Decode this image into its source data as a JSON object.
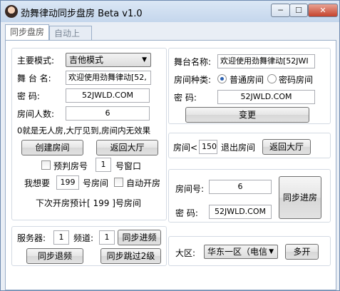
{
  "window": {
    "title": "劲舞律动同步盘房 Beta v1.0",
    "min_glyph": "─",
    "max_glyph": "☐",
    "close_glyph": "✕"
  },
  "tabs": [
    {
      "label": "同步盘房"
    },
    {
      "label": "自动上号"
    }
  ],
  "left": {
    "mode_label": "主要模式:",
    "mode_value": "吉他模式",
    "stage_name_label": "舞 台 名:",
    "stage_name_value": "欢迎使用劲舞律动[52,",
    "password_label": "密    码:",
    "password_value": "52JWLD.COM",
    "room_count_label": "房间人数:",
    "room_count_value": "6",
    "hint": "0就是无人房,大厅见到,房间内无效果",
    "create_room": "创建房间",
    "back_to_lobby": "返回大厅",
    "predict_room_label": "预判房号",
    "predict_room_value": "1",
    "window_label": "号窗口",
    "want_open_label": "我想要",
    "want_open_value": "199",
    "room_label": "号房间",
    "auto_open_label": "自动开房",
    "next_forecast": "下次开房预计[ 199 ]号房间"
  },
  "bottom_left": {
    "server_label": "服务器:",
    "server_value": "1",
    "channel_label": "频道:",
    "channel_value": "1",
    "sync_enter": "同步进频",
    "sync_exit": "同步退频",
    "sync_skip": "同步跳过2级"
  },
  "right_top": {
    "stage_name_label": "舞台名称:",
    "stage_name_value": "欢迎使用劲舞律动[52JWI",
    "room_type_label": "房间种类:",
    "normal_room": "普通房间",
    "password_room": "密码房间",
    "password_label": "密    码:",
    "password_value": "52JWLD.COM",
    "change": "变更"
  },
  "right_mid": {
    "room_lt_label": "房间<",
    "room_lt_value": "150",
    "exit_room_label": "退出房间",
    "back_to_lobby": "返回大厅"
  },
  "right_join": {
    "room_no_label": "房间号:",
    "room_no_value": "6",
    "password_label": "密    码:",
    "password_value": "52JWLD.COM",
    "sync_join": "同步进房"
  },
  "region": {
    "label": "大区:",
    "value": "华东一区（电信",
    "multi_open": "多开"
  }
}
